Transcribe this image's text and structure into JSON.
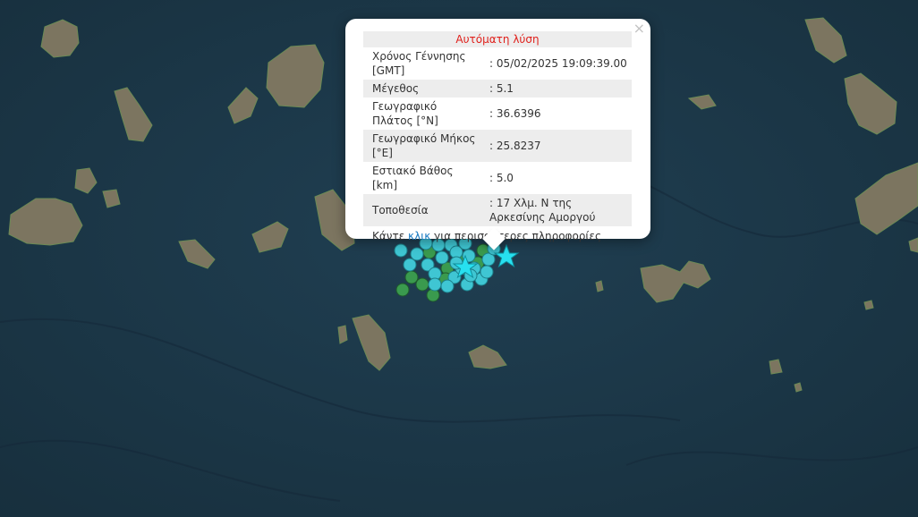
{
  "popup": {
    "close": "×",
    "title": "Αυτόματη λύση",
    "rows": [
      {
        "label": "Χρόνος Γέννησης [GMT]",
        "value": ": 05/02/2025 19:09:39.00"
      },
      {
        "label": "Μέγεθος",
        "value": ": 5.1"
      },
      {
        "label": "Γεωγραφικό Πλάτος [°N]",
        "value": ": 36.6396"
      },
      {
        "label": "Γεωγραφικό Μήκος [°E]",
        "value": ": 25.8237"
      },
      {
        "label": "Εστιακό Βάθος [km]",
        "value": ": 5.0"
      },
      {
        "label": "Τοποθεσία",
        "value": ": 17 Χλμ. Ν της Αρκεσίνης Αμοργού"
      }
    ],
    "footer_before": "Κάντε ",
    "footer_link": "κλικ",
    "footer_after": " για περισσότερες πληροφορίες"
  },
  "colors": {
    "sea": "#1c3a4a",
    "land": "#7d7660",
    "marker_recent": "#3fc6d3",
    "marker_older": "#3a9a4e",
    "star": "#27e0f0",
    "title_red": "#e0201b",
    "link_blue": "#1a7ac2"
  },
  "map": {
    "markers": "earthquake-epicenter circles",
    "stars": "main-shock-star"
  }
}
